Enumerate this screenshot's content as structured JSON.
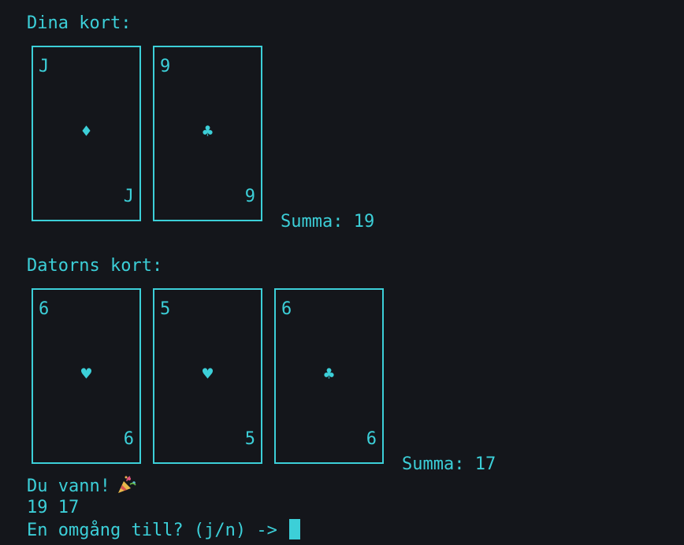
{
  "player": {
    "heading": "Dina kort:",
    "cards": [
      {
        "rank": "J",
        "suit": "♦"
      },
      {
        "rank": "9",
        "suit": "♣"
      }
    ],
    "sum": "Summa: 19"
  },
  "computer": {
    "heading": "Datorns kort:",
    "cards": [
      {
        "rank": "6",
        "suit": "♥"
      },
      {
        "rank": "5",
        "suit": "♥"
      },
      {
        "rank": "6",
        "suit": "♣"
      }
    ],
    "sum": "Summa: 17"
  },
  "result": {
    "message": "Du vann!",
    "icon": "party-popper-icon",
    "scores": "19 17"
  },
  "prompt": {
    "text": "En omgång till? (j/n) -> "
  },
  "colors": {
    "background": "#14161b",
    "foreground": "#3ccfd8"
  }
}
